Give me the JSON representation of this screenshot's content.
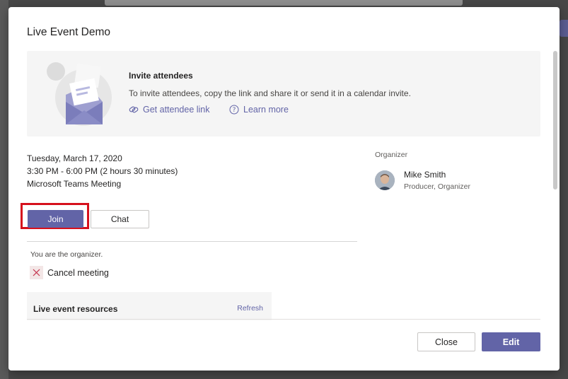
{
  "dialog": {
    "title": "Live Event Demo"
  },
  "invite": {
    "title": "Invite attendees",
    "description": "To invite attendees, copy the link and share it or send it in a calendar invite.",
    "get_link_label": "Get attendee link",
    "learn_more_label": "Learn more"
  },
  "event": {
    "date": "Tuesday, March 17, 2020",
    "time": "3:30 PM - 6:00 PM (2 hours 30 minutes)",
    "location": "Microsoft Teams Meeting"
  },
  "organizer": {
    "section_label": "Organizer",
    "name": "Mike Smith",
    "role": "Producer, Organizer"
  },
  "actions": {
    "join_label": "Join",
    "chat_label": "Chat",
    "organizer_note": "You are the organizer.",
    "cancel_label": "Cancel meeting"
  },
  "resources": {
    "title": "Live event resources",
    "refresh_label": "Refresh"
  },
  "footer": {
    "close_label": "Close",
    "edit_label": "Edit"
  },
  "colors": {
    "accent": "#6264a7",
    "highlight": "#d6101c",
    "card_bg": "#f5f5f5"
  },
  "icons": {
    "link": "link-icon",
    "help": "help-circle-icon",
    "cancel": "close-x-icon",
    "illustration": "envelope-invite-illustration"
  }
}
